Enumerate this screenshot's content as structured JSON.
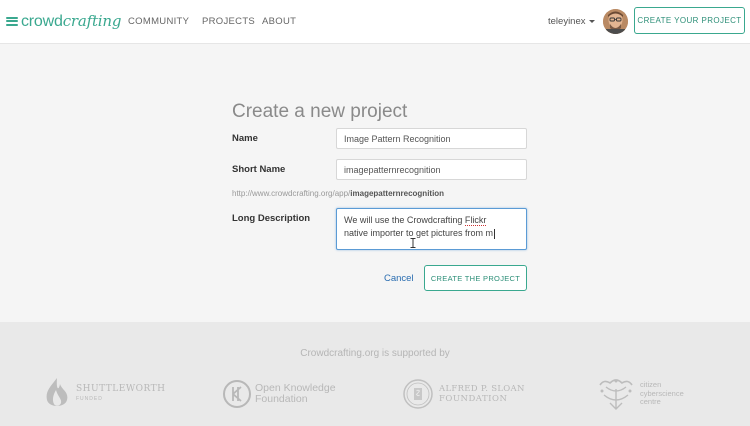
{
  "navbar": {
    "brand_part1": "crowd",
    "brand_part2": "crafting",
    "links": [
      "COMMUNITY",
      "PROJECTS",
      "ABOUT"
    ],
    "username": "teleyinex",
    "create_your_project": "CREATE YOUR PROJECT"
  },
  "form": {
    "title": "Create a new project",
    "name_label": "Name",
    "name_value": "Image Pattern Recognition",
    "short_name_label": "Short Name",
    "short_name_value": "imagepatternrecognition",
    "url_prefix": "http://www.crowdcrafting.org/app/",
    "url_suffix": "imagepatternrecognition",
    "long_description_label": "Long Description",
    "long_description_part1": "We will use the Crowdcrafting ",
    "long_description_misspelled": "Flickr",
    "long_description_part2": "native importer to get pictures from m",
    "cancel_label": "Cancel",
    "create_label": "CREATE THE PROJECT"
  },
  "footer": {
    "supported_by": "Crowdcrafting.org is supported by",
    "sponsors": {
      "shuttleworth": {
        "line1": "SHUTTLEWORTH",
        "line2": "FUNDED"
      },
      "okf": {
        "line1": "Open Knowledge",
        "line2": "Foundation"
      },
      "sloan": {
        "line1": "ALFRED P. SLOAN",
        "line2": "FOUNDATION"
      },
      "ccc": {
        "line1": "citizen",
        "line2": "cyberscience",
        "line3": "centre"
      }
    }
  },
  "colors": {
    "accent": "#3aa88f",
    "link": "#2a6db0",
    "focus": "#5b9bd5"
  },
  "icons": [
    "crowdcrafting-logo-icon",
    "caret-down-icon",
    "text-cursor-icon"
  ]
}
